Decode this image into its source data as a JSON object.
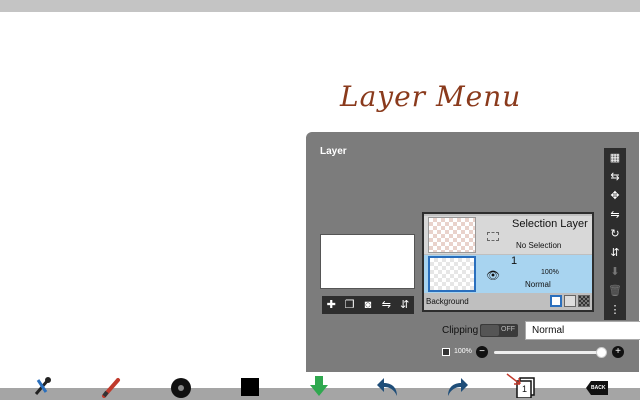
{
  "annotation": {
    "text": "Layer Menu",
    "color": "#8a3a1c"
  },
  "panel": {
    "title": "Layer",
    "preview_toolbar": [
      {
        "icon": "add-layer-icon",
        "glyph": "✚"
      },
      {
        "icon": "copy-layer-icon",
        "glyph": "❐"
      },
      {
        "icon": "camera-icon",
        "glyph": "◙"
      },
      {
        "icon": "flip-horizontal-icon",
        "glyph": "⇋"
      },
      {
        "icon": "flip-vertical-icon",
        "glyph": "⇵"
      }
    ],
    "selection_layer": {
      "name": "Selection Layer",
      "status": "No Selection"
    },
    "layer1": {
      "number": "1",
      "opacity": "100%",
      "mode": "Normal"
    },
    "background": {
      "label": "Background"
    },
    "sidebar": [
      {
        "icon": "transparency-icon",
        "glyph": "▦"
      },
      {
        "icon": "merge-icon",
        "glyph": "⇆"
      },
      {
        "icon": "move-icon",
        "glyph": "✥"
      },
      {
        "icon": "flip-horizontal-icon",
        "glyph": "⇋"
      },
      {
        "icon": "rotate-icon",
        "glyph": "↻"
      },
      {
        "icon": "flip-vertical-icon",
        "glyph": "⇵"
      },
      {
        "icon": "move-down-icon",
        "glyph": "⬇"
      },
      {
        "icon": "trash-icon",
        "glyph": "🗑"
      },
      {
        "icon": "more-icon",
        "glyph": "⋮"
      }
    ],
    "clipping": {
      "label": "Clipping",
      "state": "OFF"
    },
    "blend_mode": "Normal",
    "opacity": {
      "label": "100%",
      "value": 1.0
    }
  },
  "toolbar": [
    {
      "icon": "tools-icon"
    },
    {
      "icon": "brush-icon"
    },
    {
      "icon": "brush-size-icon"
    },
    {
      "icon": "color-icon",
      "color": "#000000"
    },
    {
      "icon": "download-icon",
      "color": "#2fa84f"
    },
    {
      "icon": "undo-icon",
      "color": "#1f4e79"
    },
    {
      "icon": "redo-icon",
      "color": "#1f4e79"
    },
    {
      "icon": "layer-icon",
      "label": "1"
    },
    {
      "icon": "back-icon",
      "label": "BACK"
    }
  ]
}
